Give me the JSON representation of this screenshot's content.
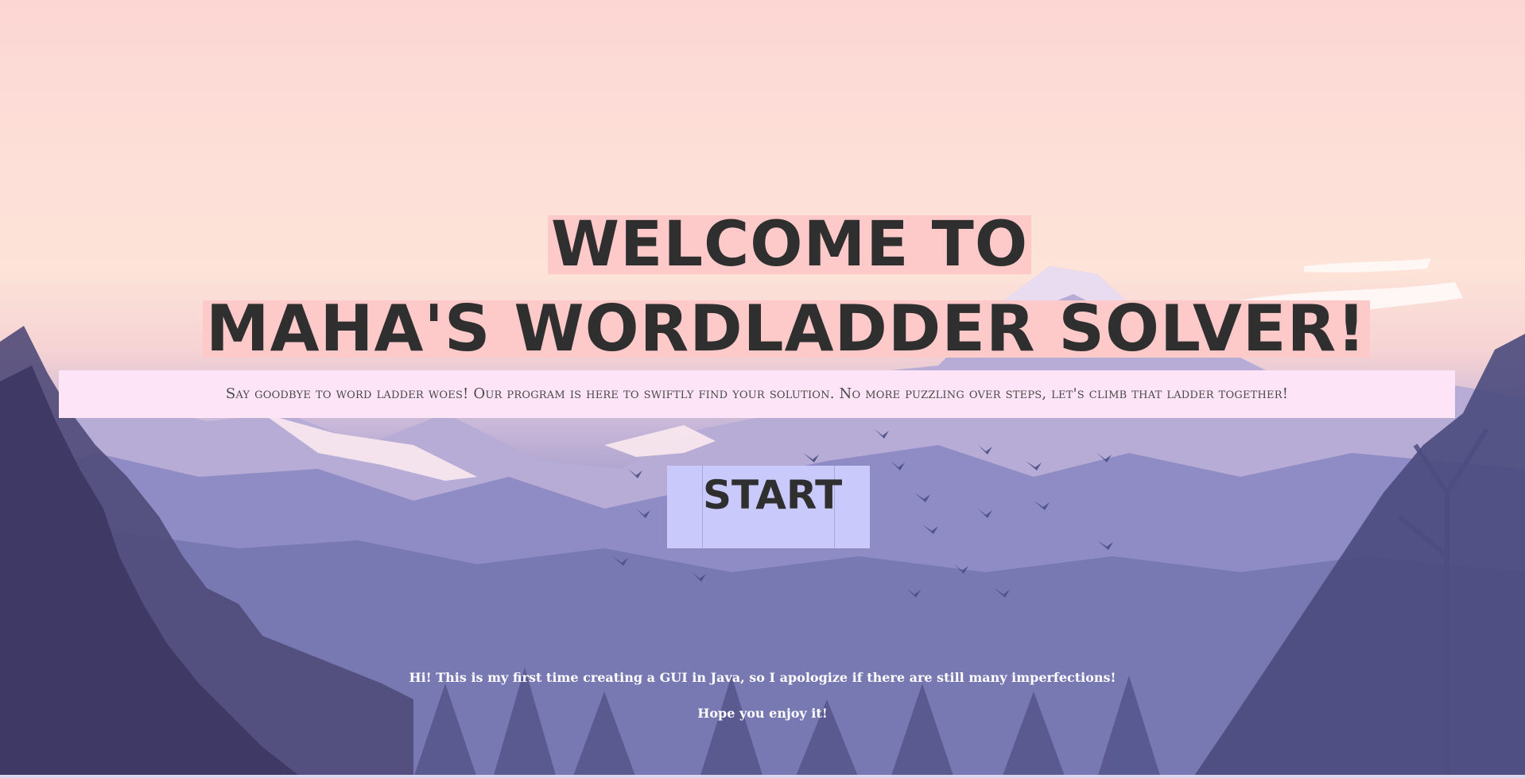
{
  "header": {
    "title_line_1": "WELCOME TO",
    "title_line_2": "MAHA'S WORDLADDER SOLVER!"
  },
  "tagline": "Say goodbye to word ladder woes! Our program is here to swiftly find your solution. No more puzzling over steps, let's climb that ladder together!",
  "start_button": {
    "label": "START"
  },
  "footer": {
    "note_1": "Hi! This is my first time creating a GUI in Java, so I apologize if there are still many imperfections!",
    "note_2": "Hope you enjoy it!"
  },
  "colors": {
    "title_highlight": "#fdcac9",
    "tagline_bg": "#fde4f7",
    "button_bg": "#c9c9fb",
    "text_dark": "#2f2f2f",
    "note_text": "#ffffff"
  },
  "background": {
    "image_name": "mountain-landscape-background",
    "icon": "birds-flock"
  }
}
